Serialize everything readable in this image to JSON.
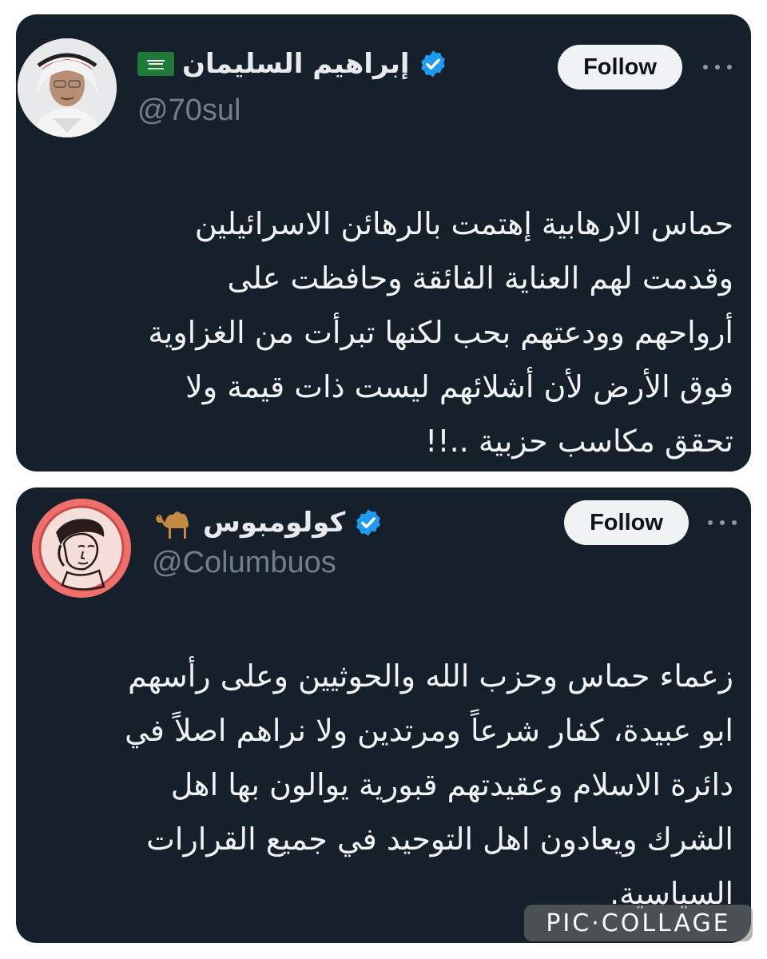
{
  "tweets": [
    {
      "display_name": "إبراهيم السليمان",
      "handle": "@70sul",
      "follow_label": "Follow",
      "flag_icon": "saudi-flag-icon",
      "text_lines": [
        "حماس الارهابية إهتمت بالرهائن الاسرائيلين",
        "وقدمت لهم العناية الفائقة وحافظت على",
        "أرواحهم وودعتهم بحب لكنها تبرأت من الغزاوية",
        "فوق الأرض لأن أشلائهم ليست ذات قيمة ولا",
        "تحقق مكاسب حزبية ..!!"
      ]
    },
    {
      "display_name": "كولومبوس",
      "handle": "@Columbuos",
      "follow_label": "Follow",
      "emoji_icon": "camel-icon",
      "text_lines": [
        "زعماء حماس وحزب الله والحوثيين وعلى رأسهم",
        "ابو عبيدة، كفار شرعاً ومرتدين ولا نراهم اصلاً في",
        "دائرة الاسلام وعقيدتهم قبورية يوالون بها اهل",
        "الشرك ويعادون اهل التوحيد في جميع القرارات",
        "السياسية."
      ]
    }
  ],
  "watermark": "PIC·COLLAGE",
  "colors": {
    "card_background": "#16202b",
    "handle": "#717f8c",
    "verified": "#1d9bf0",
    "follow_button": "#eff3f4"
  }
}
